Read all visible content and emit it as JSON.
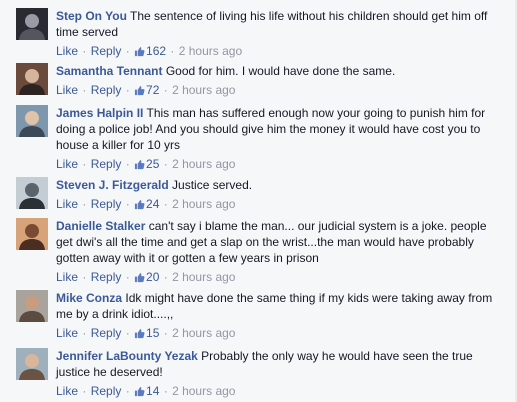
{
  "labels": {
    "like": "Like",
    "reply": "Reply"
  },
  "comments": [
    {
      "author": "Step On You",
      "text": "The sentence of living his life without his children should get him off time served",
      "likes": "162",
      "time": "2 hours ago",
      "avatar_icon": "car-photo-avatar",
      "avatar_colors": [
        "#2a2a33",
        "#9a9aa4",
        "#55555f"
      ]
    },
    {
      "author": "Samantha Tennant",
      "text": "Good for him. I would have done the same.",
      "likes": "72",
      "time": "2 hours ago",
      "avatar_icon": "couple-photo-avatar",
      "avatar_colors": [
        "#6a4a3c",
        "#d7b49c",
        "#2d2320"
      ]
    },
    {
      "author": "James Halpin II",
      "text": "This man has suffered enough now your going to punish him for doing a police job! And you should give him the money it would have cost you to house a killer for 10 yrs",
      "likes": "25",
      "time": "2 hours ago",
      "avatar_icon": "man-photo-avatar",
      "avatar_colors": [
        "#7f97ad",
        "#e0c3a8",
        "#3c4a57"
      ]
    },
    {
      "author": "Steven J. Fitzgerald",
      "text": "Justice served.",
      "likes": "24",
      "time": "2 hours ago",
      "avatar_icon": "motorcycle-photo-avatar",
      "avatar_colors": [
        "#c4ccd4",
        "#5a646e",
        "#2b3036"
      ]
    },
    {
      "author": "Danielle Stalker",
      "text": "can't say i blame the man... our judicial system is a joke. people get dwi's all the time and get a slap on the wrist...the man would have probably gotten away with it or gotten a few years in prison",
      "likes": "20",
      "time": "2 hours ago",
      "avatar_icon": "child-photo-avatar",
      "avatar_colors": [
        "#d9a37a",
        "#7a4a32",
        "#4a2e22"
      ]
    },
    {
      "author": "Mike Conza",
      "text": "Idk might have done the same thing if my kids were taking away from me by a drink idiot....,,",
      "likes": "15",
      "time": "2 hours ago",
      "avatar_icon": "man-photo-avatar",
      "avatar_colors": [
        "#a8a39c",
        "#c99c80",
        "#5b4b40"
      ]
    },
    {
      "author": "Jennifer LaBounty Yezak",
      "text": "Probably the only way he would have seen the true justice he deserved!",
      "likes": "14",
      "time": "2 hours ago",
      "avatar_icon": "woman-photo-avatar",
      "avatar_colors": [
        "#9fb0bd",
        "#d8b59b",
        "#6a5244"
      ]
    }
  ]
}
